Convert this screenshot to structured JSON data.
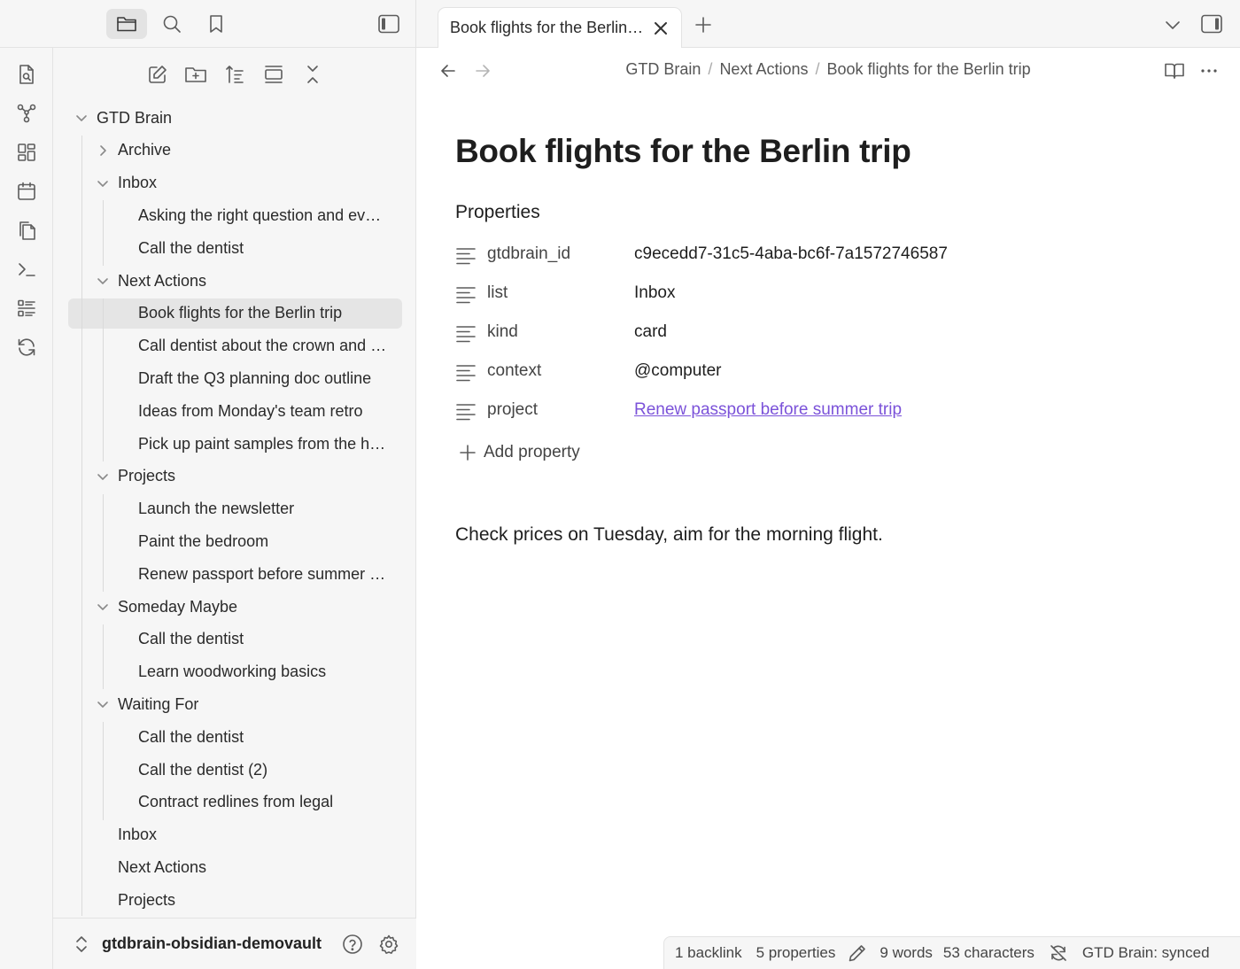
{
  "workspace": {
    "tabs": [
      {
        "title": "Book flights for the Berlin trip"
      }
    ]
  },
  "sidebar": {
    "vault_name": "gtdbrain-obsidian-demovault",
    "tree": [
      {
        "label": "GTD Brain",
        "depth": 0,
        "type": "folder",
        "expanded": true
      },
      {
        "label": "Archive",
        "depth": 1,
        "type": "folder",
        "expanded": false
      },
      {
        "label": "Inbox",
        "depth": 1,
        "type": "folder",
        "expanded": true
      },
      {
        "label": "Asking the right question and every...",
        "depth": 2,
        "type": "file"
      },
      {
        "label": "Call the dentist",
        "depth": 2,
        "type": "file"
      },
      {
        "label": "Next Actions",
        "depth": 1,
        "type": "folder",
        "expanded": true
      },
      {
        "label": "Book flights for the Berlin trip",
        "depth": 2,
        "type": "file",
        "selected": true
      },
      {
        "label": "Call dentist about the crown and the bill",
        "depth": 2,
        "type": "file"
      },
      {
        "label": "Draft the Q3 planning doc outline",
        "depth": 2,
        "type": "file"
      },
      {
        "label": "Ideas from Monday's team retro",
        "depth": 2,
        "type": "file"
      },
      {
        "label": "Pick up paint samples from the hardware store",
        "depth": 2,
        "type": "file"
      },
      {
        "label": "Projects",
        "depth": 1,
        "type": "folder",
        "expanded": true
      },
      {
        "label": "Launch the newsletter",
        "depth": 2,
        "type": "file"
      },
      {
        "label": "Paint the bedroom",
        "depth": 2,
        "type": "file"
      },
      {
        "label": "Renew passport before summer trip",
        "depth": 2,
        "type": "file"
      },
      {
        "label": "Someday Maybe",
        "depth": 1,
        "type": "folder",
        "expanded": true
      },
      {
        "label": "Call the dentist",
        "depth": 2,
        "type": "file"
      },
      {
        "label": "Learn woodworking basics",
        "depth": 2,
        "type": "file"
      },
      {
        "label": "Waiting For",
        "depth": 1,
        "type": "folder",
        "expanded": true
      },
      {
        "label": "Call the dentist",
        "depth": 2,
        "type": "file"
      },
      {
        "label": "Call the dentist (2)",
        "depth": 2,
        "type": "file"
      },
      {
        "label": "Contract redlines from legal",
        "depth": 2,
        "type": "file"
      },
      {
        "label": "Inbox",
        "depth": 1,
        "type": "file"
      },
      {
        "label": "Next Actions",
        "depth": 1,
        "type": "file"
      },
      {
        "label": "Projects",
        "depth": 1,
        "type": "file"
      }
    ]
  },
  "breadcrumb": [
    "GTD Brain",
    "Next Actions",
    "Book flights for the Berlin trip"
  ],
  "note": {
    "title": "Book flights for the Berlin trip",
    "properties_heading": "Properties",
    "properties": [
      {
        "key": "gtdbrain_id",
        "value": "c9ecedd7-31c5-4aba-bc6f-7a1572746587",
        "link": false
      },
      {
        "key": "list",
        "value": "Inbox",
        "link": false
      },
      {
        "key": "kind",
        "value": "card",
        "link": false
      },
      {
        "key": "context",
        "value": "@computer",
        "link": false
      },
      {
        "key": "project",
        "value": "Renew passport before summer trip",
        "link": true
      }
    ],
    "add_property_label": "Add property",
    "body": "Check prices on Tuesday, aim for the morning flight."
  },
  "status": {
    "backlinks": "1 backlink",
    "properties": "5 properties",
    "words": "9 words",
    "characters": "53 characters",
    "sync": "GTD Brain: synced"
  },
  "colors": {
    "accent_link": "#7b52d9",
    "sidebar_bg": "#f6f6f6",
    "selected_row": "#e5e5e5"
  }
}
